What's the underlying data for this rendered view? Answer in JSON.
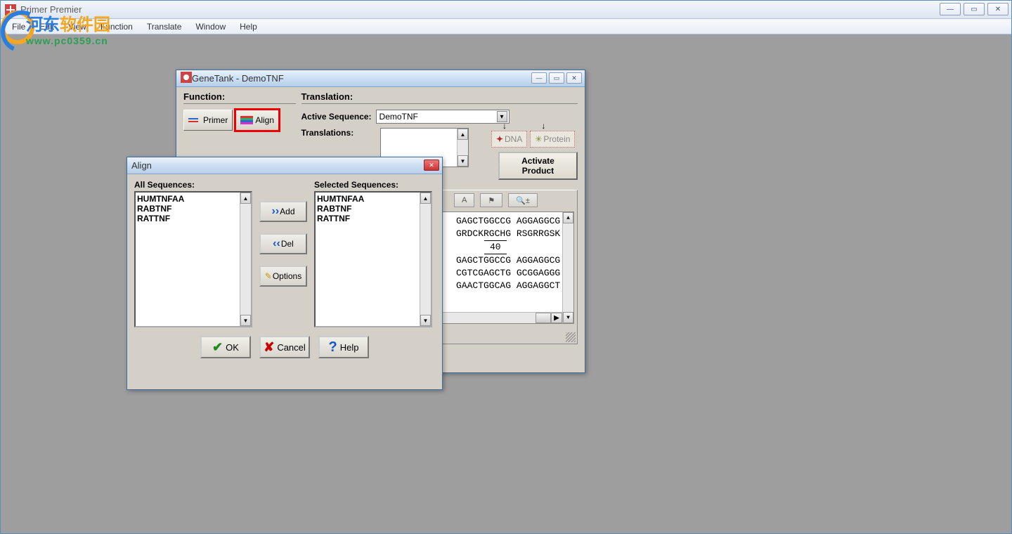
{
  "app": {
    "title": "Primer Premier",
    "menu": [
      "File",
      "Edit",
      "View",
      "Function",
      "Translate",
      "Window",
      "Help"
    ]
  },
  "watermark": {
    "text_cn": "河东软件园",
    "url": "www.pc0359.cn"
  },
  "genetank": {
    "title": "GeneTank - DemoTNF",
    "function_label": "Function:",
    "translation_label": "Translation:",
    "primer_btn": "Primer",
    "align_btn": "Align",
    "active_seq_label": "Active Sequence:",
    "active_seq_value": "DemoTNF",
    "translations_label": "Translations:",
    "dna_btn": "DNA",
    "protein_btn": "Protein",
    "activate_btn": "Activate Product",
    "toolbar": {
      "a": "A",
      "flag": "⚑",
      "zoom": "🔍±"
    },
    "seq_lines": [
      "GAGCTGGCCG AGGAGGCG",
      "GRDCKRGCHG RSGRRGSK",
      "40",
      "GAGCTGGCCG AGGAGGCG",
      "CGTCGAGCTG GCGGAGGG",
      "GAACTGGCAG AGGAGGCT"
    ]
  },
  "align": {
    "title": "Align",
    "all_label": "All Sequences:",
    "selected_label": "Selected Sequences:",
    "all_items": [
      "HUMTNFAA",
      "RABTNF",
      "RATTNF"
    ],
    "selected_items": [
      "HUMTNFAA",
      "RABTNF",
      "RATTNF"
    ],
    "add_btn": "Add",
    "del_btn": "Del",
    "options_btn": "Options",
    "ok_btn": "OK",
    "cancel_btn": "Cancel",
    "help_btn": "Help"
  }
}
